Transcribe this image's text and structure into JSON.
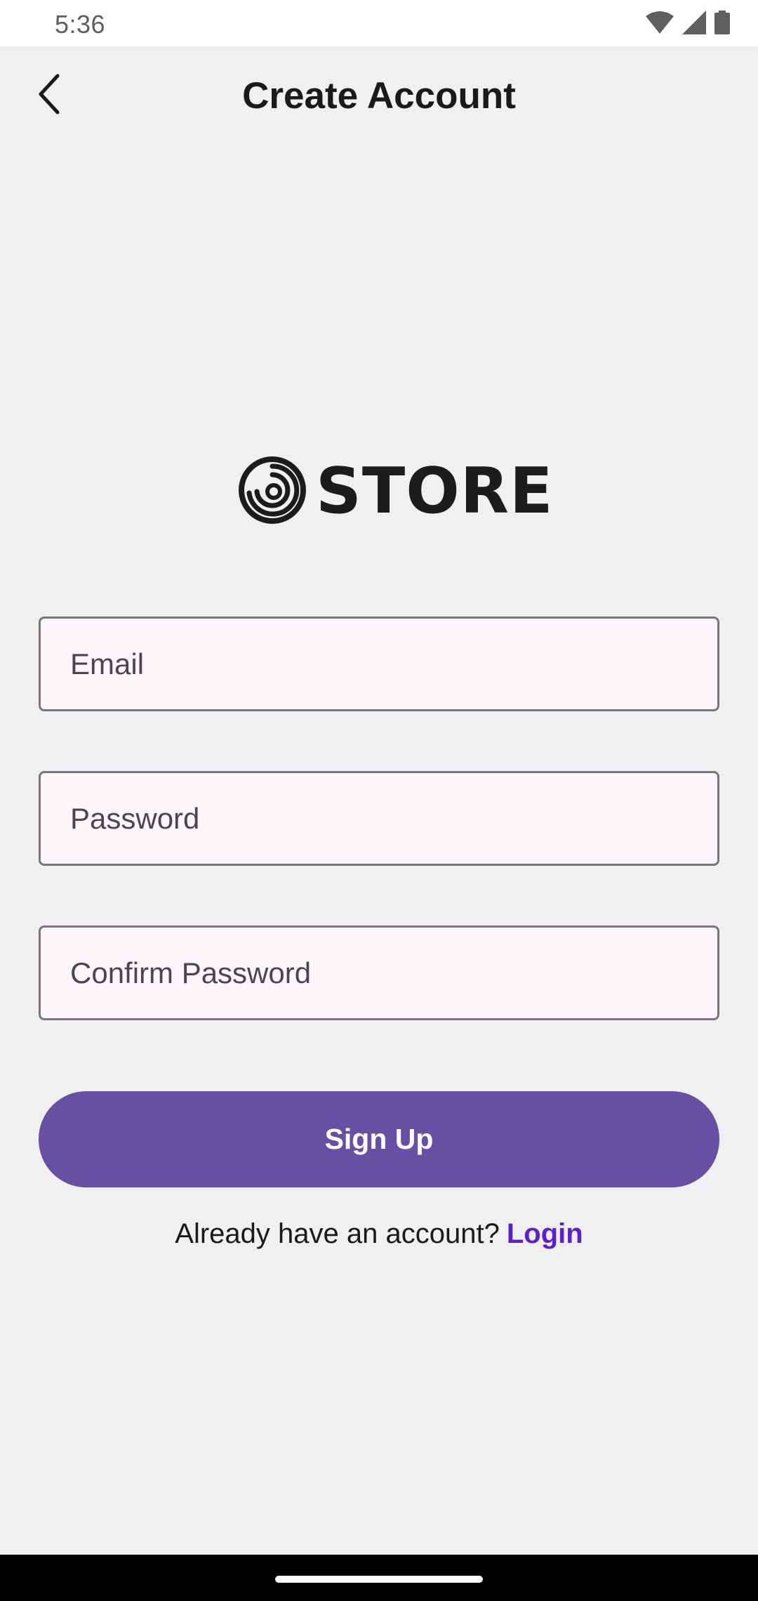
{
  "status_bar": {
    "time": "5:36",
    "icons": [
      "wifi-icon",
      "signal-icon",
      "battery-icon"
    ]
  },
  "header": {
    "title": "Create Account",
    "back_icon": "chevron-left-icon"
  },
  "logo": {
    "wordmark": "STORE",
    "icon": "swirl-logo-icon"
  },
  "form": {
    "email_placeholder": "Email",
    "password_placeholder": "Password",
    "confirm_placeholder": "Confirm Password",
    "signup_label": "Sign Up"
  },
  "footer": {
    "prompt": "Already have an account?",
    "login_label": "Login"
  },
  "colors": {
    "background": "#f0f0f0",
    "primary": "#6750a4",
    "link": "#5a1fd1",
    "field_background": "#fdf7fc",
    "field_border": "#7a7580"
  }
}
